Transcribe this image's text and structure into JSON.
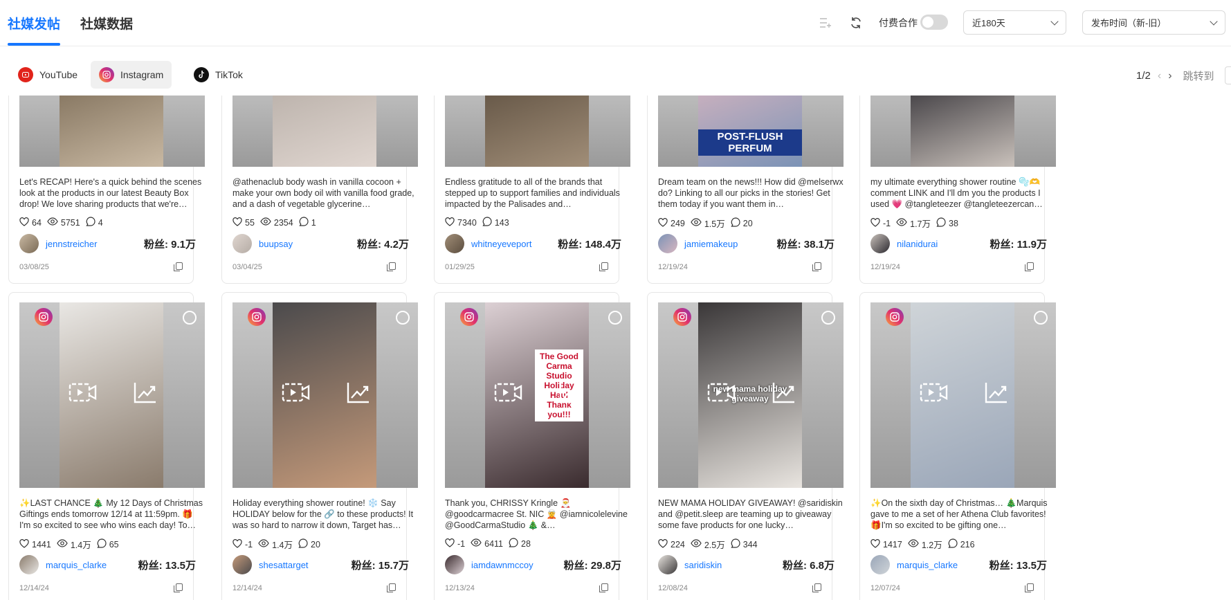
{
  "header": {
    "tabs": [
      {
        "label": "社媒发帖"
      },
      {
        "label": "社媒数据"
      }
    ],
    "paid_label": "付费合作",
    "range_select": "近180天",
    "sort_select": "发布时间（新-旧）"
  },
  "platforms": [
    {
      "label": "YouTube"
    },
    {
      "label": "Instagram"
    },
    {
      "label": "TikTok"
    }
  ],
  "pager": {
    "page": "1/2",
    "jump_label": "跳转到"
  },
  "cards": [
    {
      "caption": "Let's RECAP! Here's a quick behind the scenes look at the products in our latest Beauty Box drop! We love sharing products that we're…",
      "likes": "64",
      "views": "5751",
      "comments": "4",
      "handle": "jennstreicher",
      "fans": "粉丝: 9.1万",
      "date": "03/08/25"
    },
    {
      "caption": "@athenaclub body wash in vanilla cocoon + make your own body oil with vanilla food grade, and a dash of vegetable glycerine…",
      "likes": "55",
      "views": "2354",
      "comments": "1",
      "handle": "buupsay",
      "fans": "粉丝: 4.2万",
      "date": "03/04/25"
    },
    {
      "caption": "Endless gratitude to all of the brands that stepped up to support families and individuals impacted by the Palisades and…",
      "likes": "7340",
      "views": "",
      "comments": "143",
      "handle": "whitneyeveport",
      "fans": "粉丝: 148.4万",
      "date": "01/29/25"
    },
    {
      "caption": "Dream team on the news!!! How did @melserwx do? Linking to all our picks in the stories! Get them today if you want them in…",
      "likes": "249",
      "views": "1.5万",
      "comments": "20",
      "handle": "jamiemakeup",
      "fans": "粉丝: 38.1万",
      "date": "12/19/24"
    },
    {
      "caption": "my ultimate everything shower routine 🫧🫶 comment LINK and I'll dm you the products I used 💗 @tangleteezer @tangleteezercan…",
      "likes": "-1",
      "views": "1.7万",
      "comments": "38",
      "handle": "nilanidurai",
      "fans": "粉丝: 11.9万",
      "date": "12/19/24"
    },
    {
      "caption": "✨LAST CHANCE 🎄 My 12 Days of Christmas Giftings ends tomorrow 12/14 at 11:59pm. 🎁 I'm so excited to see who wins each day! To…",
      "likes": "1441",
      "views": "1.4万",
      "comments": "65",
      "handle": "marquis_clarke",
      "fans": "粉丝: 13.5万",
      "date": "12/14/24"
    },
    {
      "caption": "Holiday everything shower routine! ❄️ Say HOLIDAY below for the 🔗 to these products! It was so hard to narrow it down, Target has…",
      "likes": "-1",
      "views": "1.4万",
      "comments": "20",
      "handle": "shesattarget",
      "fans": "粉丝: 15.7万",
      "date": "12/14/24"
    },
    {
      "caption": "Thank you, CHRISSY Kringle 🎅 @goodcarmacree St. NIC 🧝 @iamnicolelevine @GoodCarmaStudio 🎄 &…",
      "likes": "-1",
      "views": "6411",
      "comments": "28",
      "handle": "iamdawnmccoy",
      "fans": "粉丝: 29.8万",
      "date": "12/13/24"
    },
    {
      "caption": "NEW MAMA HOLIDAY GIVEAWAY! @saridiskin and @petit.sleep are teaming up to giveaway some fave products for one lucky…",
      "likes": "224",
      "views": "2.5万",
      "comments": "344",
      "handle": "saridiskin",
      "fans": "粉丝: 6.8万",
      "date": "12/08/24"
    },
    {
      "caption": "✨On the sixth day of Christmas… 🎄Marquis gave to me a set of her Athena Club favorites! 🎁I'm so excited to be gifting one…",
      "likes": "1417",
      "views": "1.2万",
      "comments": "216",
      "handle": "marquis_clarke",
      "fans": "粉丝: 13.5万",
      "date": "12/07/24"
    }
  ],
  "thumb_text": {
    "card_4": "POST-FLUSH PERFUM",
    "card_8": "The Good Carma Studio Holiday Haul Thank you!!!",
    "card_9": "new mama holiday giveaway"
  },
  "colors": {
    "accent": "#1677ff",
    "instagram": "#e1306c",
    "youtube": "#e1241b"
  }
}
